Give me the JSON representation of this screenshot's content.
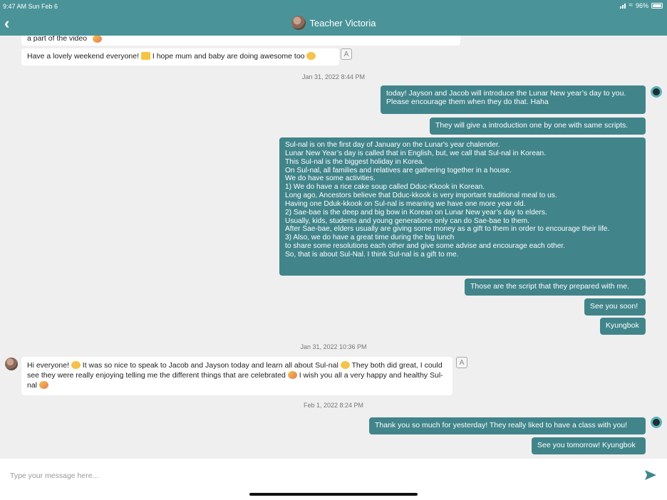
{
  "status_bar": {
    "time": "9:47 AM  Sun Feb 6",
    "battery": "96%"
  },
  "header": {
    "title": "Teacher Victoria",
    "back_icon": "chevron-left-icon"
  },
  "messages": {
    "m1_partial": "a part of the video",
    "m2": "Have a lovely weekend everyone!",
    "m2b": "I hope mum and baby are doing awesome too",
    "date1": "Jan 31, 2022 8:44 PM",
    "o1": "today! Jayson and Jacob will introduce the Lunar New year’s day to you.\nPlease encourage them when they do that. Haha",
    "o2": "They will give a introduction one by one with same scripts.",
    "o3": "Sul-nal is on the first day of January on the Lunar's year chalender.\nLunar New Year’s day is called that in English, but, we call that Sul-nal in Korean.\nThis Sul-nal is the biggest holiday in Korea.\nOn Sul-nal, all families and relatives are gathering together in a house.\nWe do have some activities.\n1) We do have a rice cake soup called Dduc-Kkook in Korean.\nLong ago, Ancestors believe that Dduc-kkook is very important traditional meal to us.\nHaving one Dduk-kkook on Sul-nal is meaning we have one more year old.\n2) Sae-bae is the deep and big bow in Korean on Lunar New year’s day to elders.\nUsually, kids, students and young generations only can do Sae-bae to them.\nAfter Sae-bae, elders usually are giving some money as a gift to them in order to encourage their life.\n3) Also, we do have a great time during the big lunch\nto share some resolutions each other and give some advise and encourage each other.\nSo, that is about Sul-Nal. I think Sul-nal is a gift to me.",
    "o4": "Those are the script that they prepared with me.",
    "o5": "See you soon!",
    "o6": "Kyungbok",
    "date2": "Jan 31, 2022 10:36 PM",
    "i3a": "Hi everyone!",
    "i3b": "It was so nice to speak to Jacob and Jayson today and learn all about Sul-nal",
    "i3c": "They both did great, I could see they were really enjoying telling me the different things that are celebrated",
    "i3d": "I wish you all a very happy and healthy Sul-nal",
    "date3": "Feb 1, 2022 8:24 PM",
    "o7": "Thank you so much for yesterday! They really liked to have a class with you!",
    "o8": "See you tomorrow! Kyungbok"
  },
  "composer": {
    "placeholder": "Type your message here...",
    "send_icon": "send-icon"
  },
  "colors": {
    "header": "#4a9499",
    "outgoing_bubble": "#41858b",
    "incoming_bubble": "#ffffff",
    "background": "#efeff0"
  }
}
